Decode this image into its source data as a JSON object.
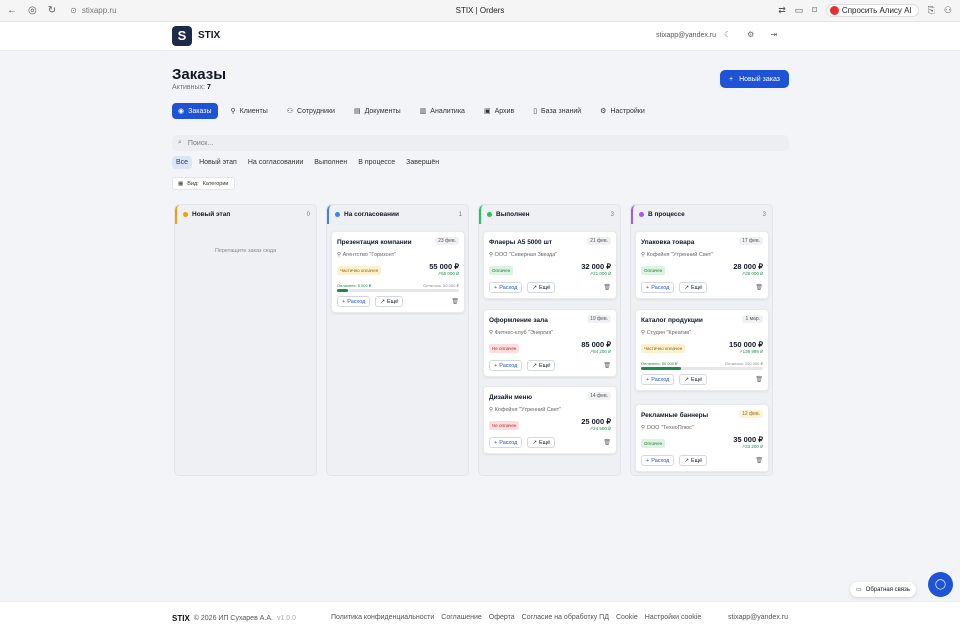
{
  "browser": {
    "url": "stixapp.ru",
    "title": "STIX | Orders",
    "alice": "Спросить Алису AI"
  },
  "header": {
    "logo": "S",
    "brand": "STIX",
    "email": "stixapp@yandex.ru"
  },
  "page": {
    "title": "Заказы",
    "active_label": "Активных:",
    "active_count": "7",
    "new_order": "Новый заказ"
  },
  "tabs": [
    "Заказы",
    "Клиенты",
    "Сотрудники",
    "Документы",
    "Аналитика",
    "Архив",
    "База знаний",
    "Настройки"
  ],
  "search": {
    "placeholder": "Поиск..."
  },
  "filters": [
    "Все",
    "Новый этап",
    "На согласовании",
    "Выполнен",
    "В процессе",
    "Завершён"
  ],
  "view": {
    "label": "Вид:",
    "value": "Категории"
  },
  "columns": [
    {
      "title": "Новый этап",
      "count": "0",
      "color": "#f59e0b",
      "empty": "Перетащите заказ сюда",
      "cards": []
    },
    {
      "title": "На согласовании",
      "count": "1",
      "color": "#3b82f6",
      "cards": [
        {
          "title": "Презентация компании",
          "date": "23 фев.",
          "client": "Агентство \"Горизонт\"",
          "status": "Частично оплачен",
          "amount": "55 000 ₽",
          "sub": "55 000 ₽",
          "paid": "Оплачено: 5 000 ₽",
          "left": "Осталось: 50 000 ₽",
          "progress": 0.09,
          "expense": "Расход",
          "more": "Ещё"
        }
      ]
    },
    {
      "title": "Выполнен",
      "count": "3",
      "color": "#22c55e",
      "cards": [
        {
          "title": "Флаеры А5 5000 шт",
          "date": "21 фев.",
          "client": "ООО \"Северная Звезда\"",
          "status": "Оплачен",
          "amount": "32 000 ₽",
          "sub": "21 000 ₽",
          "expense": "Расход",
          "more": "Ещё"
        },
        {
          "title": "Оформление зала",
          "date": "19 фев.",
          "client": "Фитнес-клуб \"Энергия\"",
          "status": "Не оплачен",
          "amount": "85 000 ₽",
          "sub": "84 200 ₽",
          "expense": "Расход",
          "more": "Ещё"
        },
        {
          "title": "Дизайн меню",
          "date": "14 фев.",
          "client": "Кофейня \"Утренний Свет\"",
          "status": "Не оплачен",
          "amount": "25 000 ₽",
          "sub": "24 500 ₽",
          "expense": "Расход",
          "more": "Ещё"
        }
      ]
    },
    {
      "title": "В процессе",
      "count": "3",
      "color": "#a855f7",
      "cards": [
        {
          "title": "Упаковка товара",
          "date": "17 фев.",
          "client": "Кофейня \"Утренний Свет\"",
          "status": "Оплачен",
          "amount": "28 000 ₽",
          "sub": "28 000 ₽",
          "expense": "Расход",
          "more": "Ещё"
        },
        {
          "title": "Каталог продукции",
          "date": "1 мар.",
          "client": "Студия \"Креатив\"",
          "status": "Частично оплачен",
          "amount": "150 000 ₽",
          "sub": "139 999 ₽",
          "paid": "Оплачено: 50 000 ₽",
          "left": "Осталось: 100 000 ₽",
          "progress": 0.33,
          "expense": "Расход",
          "more": "Ещё"
        },
        {
          "title": "Рекламные баннеры",
          "date": "12 фев.",
          "client": "ООО \"ТехноПлюс\"",
          "status": "Оплачен",
          "amount": "35 000 ₽",
          "sub": "33 200 ₽",
          "expense": "Расход",
          "more": "Ещё"
        }
      ]
    }
  ],
  "feedback": "Обратная связь",
  "footer": {
    "brand": "STIX",
    "copy": "© 2026 ИП Сухарев А.А.",
    "version": "v1.0.0",
    "links": [
      "Политика конфиденциальности",
      "Соглашение",
      "Оферта",
      "Согласие на обработку ПД",
      "Cookie",
      "Настройки cookie"
    ],
    "email": "stixapp@yandex.ru"
  }
}
